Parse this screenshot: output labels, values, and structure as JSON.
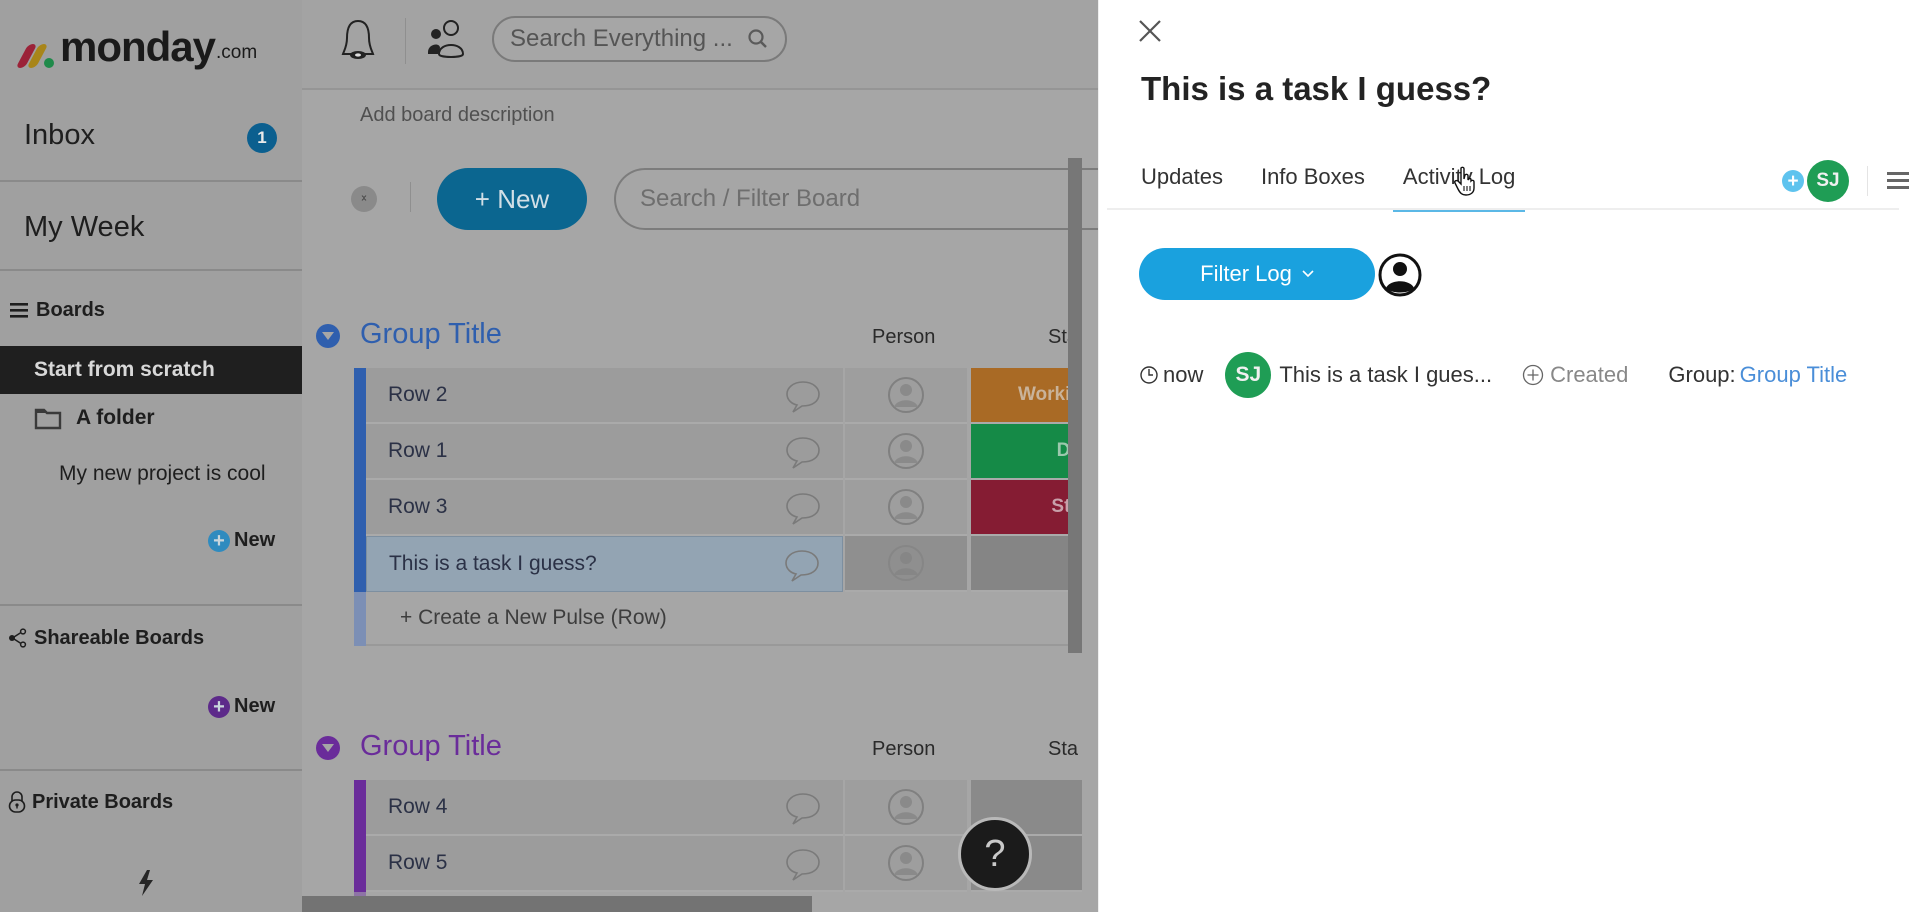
{
  "brand": {
    "name": "monday",
    "suffix": ".com",
    "mark_colors": [
      "#b9233f",
      "#c49a1c",
      "#1f9d55"
    ]
  },
  "sidebar": {
    "inbox_label": "Inbox",
    "inbox_count": "1",
    "my_week_label": "My Week",
    "boards_label": "Boards",
    "start_from_scratch": "Start from scratch",
    "folder_label": "A folder",
    "project_item": "My new project is cool",
    "new_label_1": "New",
    "shareable_label": "Shareable Boards",
    "new_label_2": "New",
    "private_label": "Private Boards"
  },
  "topbar": {
    "search_placeholder": "Search Everything ..."
  },
  "board": {
    "description_placeholder": "Add board description",
    "new_button": "+ New",
    "filter_placeholder": "Search / Filter Board",
    "help_label": "?",
    "groups": [
      {
        "title": "Group Title",
        "color": "#2f5fae",
        "col_person": "Person",
        "col_status": "Sta",
        "rows": [
          {
            "name": "Row 2",
            "status": "Workin",
            "status_color": "#a96a25"
          },
          {
            "name": "Row 1",
            "status": "Do",
            "status_color": "#158a47"
          },
          {
            "name": "Row 3",
            "status": "Stu",
            "status_color": "#851c33"
          },
          {
            "name": "This is a task I guess?",
            "status": "",
            "status_color": "#8a8a8a",
            "selected": true
          }
        ],
        "create_row": "+ Create a New Pulse (Row)"
      },
      {
        "title": "Group Title",
        "color": "#6a2c9a",
        "col_person": "Person",
        "col_status": "Sta",
        "rows": [
          {
            "name": "Row 4",
            "status": "",
            "status_color": "#8a8a8a"
          },
          {
            "name": "Row 5",
            "status": "",
            "status_color": "#8a8a8a"
          }
        ]
      }
    ]
  },
  "panel": {
    "title": "This is a task I guess?",
    "tabs": [
      {
        "label": "Updates",
        "active": false
      },
      {
        "label": "Info Boxes",
        "active": false
      },
      {
        "label": "Activity Log",
        "active": true
      }
    ],
    "subscriber_initials": "SJ",
    "filter_button": "Filter Log",
    "log": [
      {
        "time": "now",
        "user_initials": "SJ",
        "item": "This is a task I gues...",
        "action": "Created",
        "group_label": "Group:",
        "group_value": "Group Title"
      }
    ]
  }
}
